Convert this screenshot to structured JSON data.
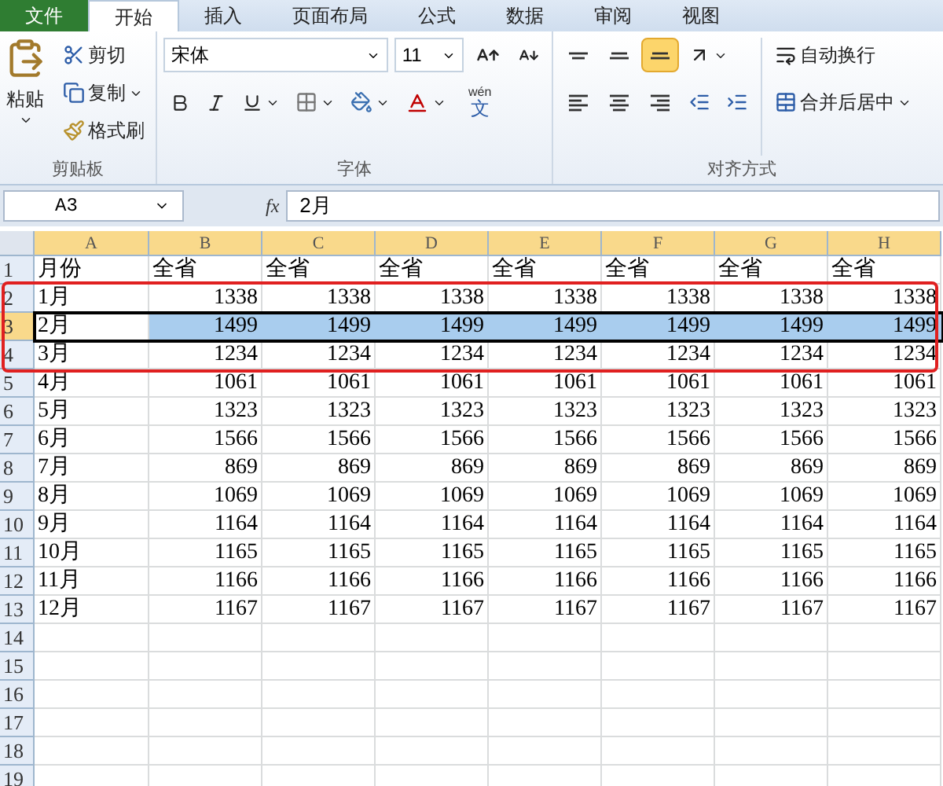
{
  "ribbon_tabs": [
    {
      "label": "文件",
      "kind": "file",
      "selected": false
    },
    {
      "label": "开始",
      "kind": "tab",
      "selected": true
    },
    {
      "label": "插入",
      "kind": "tab",
      "selected": false
    },
    {
      "label": "页面布局",
      "kind": "tab",
      "selected": false
    },
    {
      "label": "公式",
      "kind": "tab",
      "selected": false
    },
    {
      "label": "数据",
      "kind": "tab",
      "selected": false
    },
    {
      "label": "审阅",
      "kind": "tab",
      "selected": false
    },
    {
      "label": "视图",
      "kind": "tab",
      "selected": false
    }
  ],
  "clipboard": {
    "paste": "粘贴",
    "cut": "剪切",
    "copy": "复制",
    "format_painter": "格式刷",
    "label": "剪贴板"
  },
  "font": {
    "name": "宋体",
    "size": "11",
    "phonetic_ruby": "wén",
    "phonetic_base": "文",
    "label": "字体"
  },
  "alignment": {
    "buttons": [
      {
        "kind": "top",
        "selected": false
      },
      {
        "kind": "middle",
        "selected": false
      },
      {
        "kind": "bottom",
        "selected": true
      },
      {
        "kind": "left",
        "selected": false
      },
      {
        "kind": "center",
        "selected": false
      },
      {
        "kind": "right",
        "selected": false
      }
    ],
    "wrap_text": "自动换行",
    "merge_center": "合并后居中",
    "label": "对齐方式"
  },
  "formula_bar": {
    "name_box": "A3",
    "fx": "fx",
    "formula": "2月"
  },
  "columns": [
    {
      "label": "A",
      "highlighted": true
    },
    {
      "label": "B",
      "highlighted": true
    },
    {
      "label": "C",
      "highlighted": true
    },
    {
      "label": "D",
      "highlighted": true
    },
    {
      "label": "E",
      "highlighted": true
    },
    {
      "label": "F",
      "highlighted": true
    },
    {
      "label": "G",
      "highlighted": true
    },
    {
      "label": "H",
      "highlighted": true
    }
  ],
  "rows": [
    {
      "number": "1",
      "selected": false,
      "circled": false,
      "cells": [
        "月份",
        "全省",
        "全省",
        "全省",
        "全省",
        "全省",
        "全省",
        "全省"
      ]
    },
    {
      "number": "2",
      "selected": false,
      "circled": true,
      "cells": [
        "1月",
        "1338",
        "1338",
        "1338",
        "1338",
        "1338",
        "1338",
        "1338"
      ]
    },
    {
      "number": "3",
      "selected": true,
      "circled": true,
      "cells": [
        "2月",
        "1499",
        "1499",
        "1499",
        "1499",
        "1499",
        "1499",
        "1499"
      ]
    },
    {
      "number": "4",
      "selected": false,
      "circled": true,
      "cells": [
        "3月",
        "1234",
        "1234",
        "1234",
        "1234",
        "1234",
        "1234",
        "1234"
      ]
    },
    {
      "number": "5",
      "selected": false,
      "circled": false,
      "cells": [
        "4月",
        "1061",
        "1061",
        "1061",
        "1061",
        "1061",
        "1061",
        "1061"
      ]
    },
    {
      "number": "6",
      "selected": false,
      "circled": false,
      "cells": [
        "5月",
        "1323",
        "1323",
        "1323",
        "1323",
        "1323",
        "1323",
        "1323"
      ]
    },
    {
      "number": "7",
      "selected": false,
      "circled": false,
      "cells": [
        "6月",
        "1566",
        "1566",
        "1566",
        "1566",
        "1566",
        "1566",
        "1566"
      ]
    },
    {
      "number": "8",
      "selected": false,
      "circled": false,
      "cells": [
        "7月",
        "869",
        "869",
        "869",
        "869",
        "869",
        "869",
        "869"
      ]
    },
    {
      "number": "9",
      "selected": false,
      "circled": false,
      "cells": [
        "8月",
        "1069",
        "1069",
        "1069",
        "1069",
        "1069",
        "1069",
        "1069"
      ]
    },
    {
      "number": "10",
      "selected": false,
      "circled": false,
      "cells": [
        "9月",
        "1164",
        "1164",
        "1164",
        "1164",
        "1164",
        "1164",
        "1164"
      ]
    },
    {
      "number": "11",
      "selected": false,
      "circled": false,
      "cells": [
        "10月",
        "1165",
        "1165",
        "1165",
        "1165",
        "1165",
        "1165",
        "1165"
      ]
    },
    {
      "number": "12",
      "selected": false,
      "circled": false,
      "cells": [
        "11月",
        "1166",
        "1166",
        "1166",
        "1166",
        "1166",
        "1166",
        "1166"
      ]
    },
    {
      "number": "13",
      "selected": false,
      "circled": false,
      "cells": [
        "12月",
        "1167",
        "1167",
        "1167",
        "1167",
        "1167",
        "1167",
        "1167"
      ]
    },
    {
      "number": "14",
      "selected": false,
      "circled": false,
      "cells": []
    },
    {
      "number": "15",
      "selected": false,
      "circled": false,
      "cells": []
    },
    {
      "number": "16",
      "selected": false,
      "circled": false,
      "cells": []
    },
    {
      "number": "17",
      "selected": false,
      "circled": false,
      "cells": []
    },
    {
      "number": "18",
      "selected": false,
      "circled": false,
      "cells": []
    },
    {
      "number": "19",
      "selected": false,
      "circled": false,
      "cells": []
    }
  ]
}
